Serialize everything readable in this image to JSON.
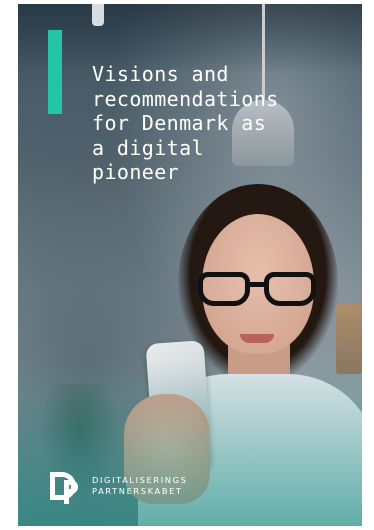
{
  "cover": {
    "title_lines": [
      "Visions and",
      "recommendations",
      "for Denmark as",
      "a digital",
      "pioneer"
    ],
    "brand_lines": [
      "DIGITALISERINGS",
      "PARTNERSKABET"
    ],
    "logo_icon": "dp-logo-icon"
  },
  "colors": {
    "accent": "#23c4a8",
    "title_text": "#ffffff"
  }
}
